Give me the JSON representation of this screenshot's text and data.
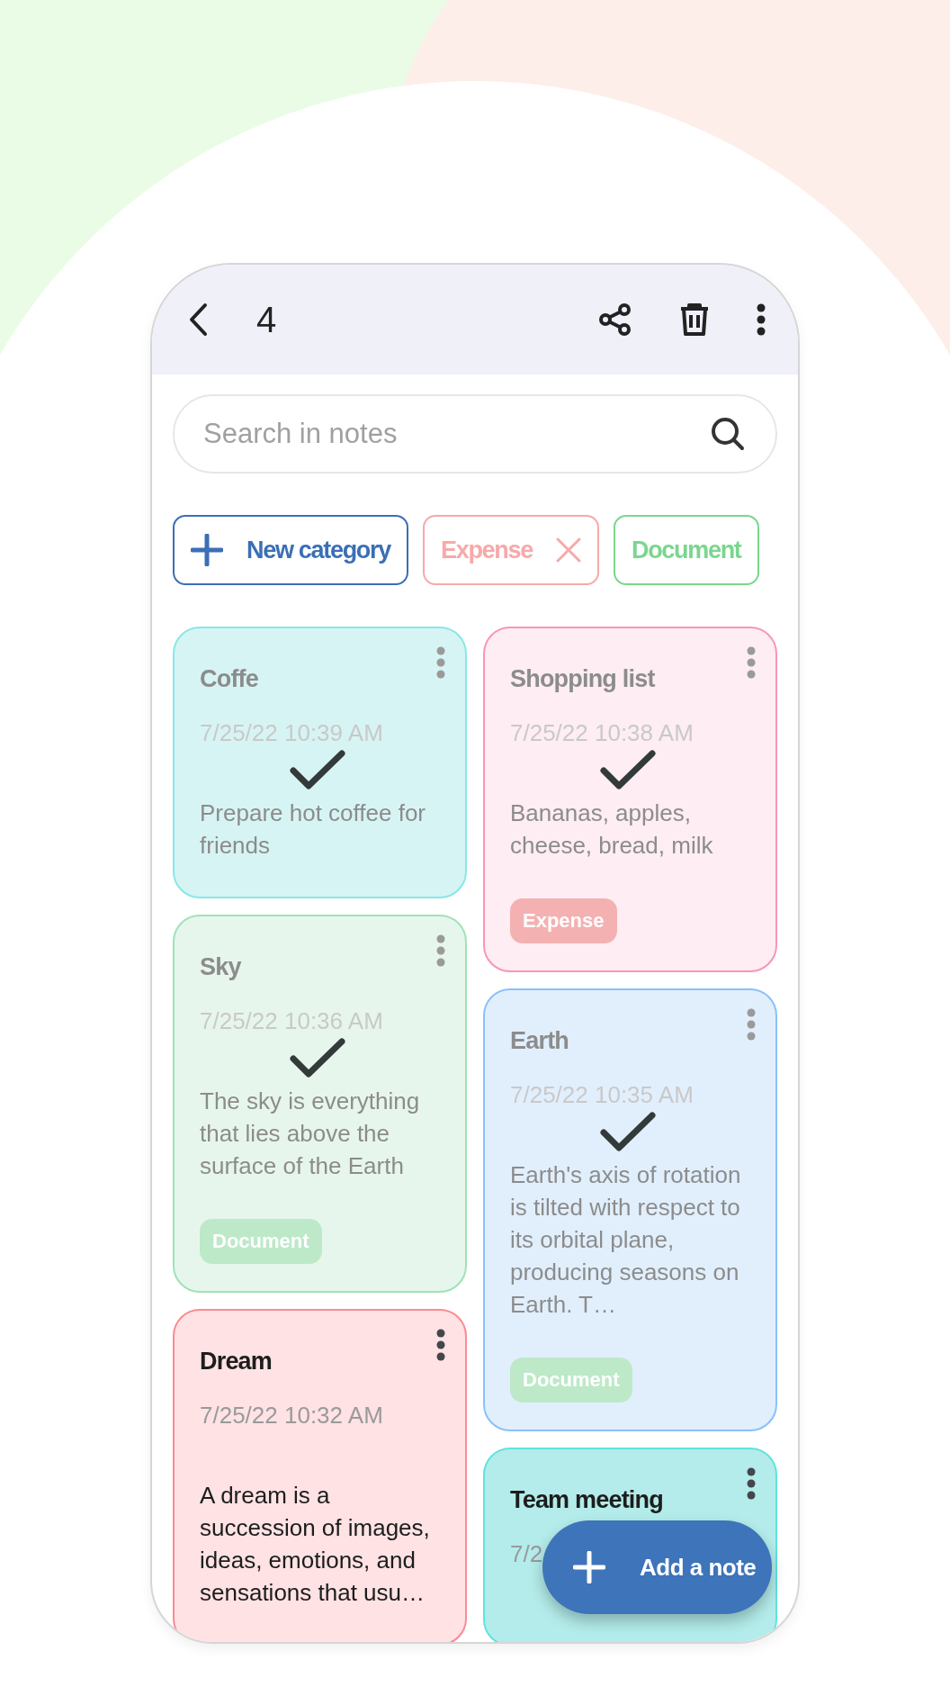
{
  "header": {
    "count": "4"
  },
  "search": {
    "placeholder": "Search in notes"
  },
  "categories": [
    {
      "kind": "add",
      "label": "New category",
      "color": "#3b6fb6"
    },
    {
      "kind": "filter",
      "label": "Expense",
      "color": "#f7a9a9"
    },
    {
      "kind": "filter",
      "label": "Document",
      "color": "#7ad68e"
    }
  ],
  "columns": [
    [
      {
        "title": "Coffe",
        "date": "7/25/22 10:39 AM",
        "body": "Prepare hot coffee for friends",
        "color": "#d7f4f4",
        "selected": true
      },
      {
        "title": "Sky",
        "date": "7/25/22 10:36 AM",
        "body": "The sky is everything that lies above the surface of the Earth",
        "color": "#e7f6ec",
        "selected": true,
        "tag": {
          "label": "Document",
          "color": "#bde9c8"
        }
      },
      {
        "title": "Dream",
        "date": "7/25/22 10:32 AM",
        "body": "A dream is a succession of images, ideas, emotions, and sensations that usu…",
        "color": "#fee2e4",
        "selected": false
      }
    ],
    [
      {
        "title": "Shopping list",
        "date": "7/25/22 10:38 AM",
        "body": "Bananas, apples, cheese, bread, milk",
        "color": "#feedf2",
        "selected": true,
        "tag": {
          "label": "Expense",
          "color": "#f4b1b1"
        }
      },
      {
        "title": "Earth",
        "date": "7/25/22 10:35 AM",
        "body": "Earth's axis of rotation is tilted with respect to its orbital plane, producing seasons on Earth. T…",
        "color": "#e1effd",
        "selected": true,
        "tag": {
          "label": "Document",
          "color": "#bde9c8"
        }
      },
      {
        "title": "Team meeting",
        "date": "7/2",
        "color": "#b3ecea",
        "selected": false
      }
    ]
  ],
  "fab": {
    "label": "Add a note"
  }
}
